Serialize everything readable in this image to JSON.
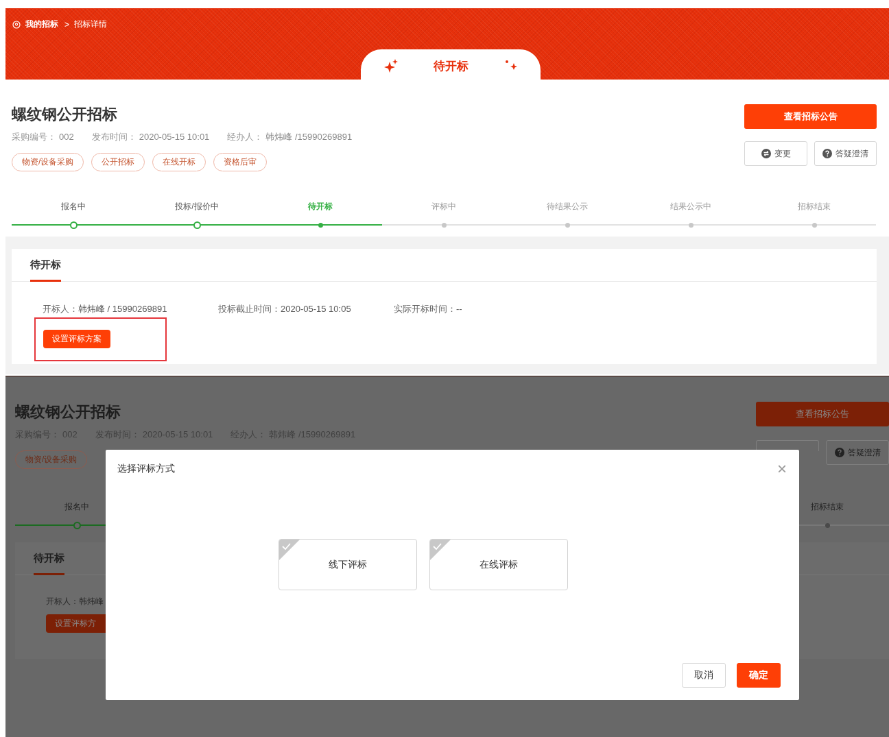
{
  "breadcrumb": {
    "items": [
      "我的招标",
      "招标详情"
    ],
    "separator": ">"
  },
  "status_tab": {
    "label": "待开标"
  },
  "project": {
    "title": "螺纹钢公开招标",
    "meta": [
      {
        "label": "采购编号：",
        "value": "002"
      },
      {
        "label": "发布时间：",
        "value": "2020-05-15 10:01"
      },
      {
        "label": "经办人：",
        "value": "韩炜峰 /15990269891"
      }
    ],
    "tags": [
      "物资/设备采购",
      "公开招标",
      "在线开标",
      "资格后审"
    ],
    "primary_button": "查看招标公告",
    "secondary_buttons": [
      {
        "kind": "change",
        "label": "变更"
      },
      {
        "kind": "question",
        "label": "答疑澄清"
      }
    ]
  },
  "steps": [
    {
      "label": "报名中",
      "kind": "done"
    },
    {
      "label": "投标/报价中",
      "kind": "done"
    },
    {
      "label": "待开标",
      "kind": "current"
    },
    {
      "label": "评标中",
      "kind": "pending"
    },
    {
      "label": "待结果公示",
      "kind": "pending"
    },
    {
      "label": "结果公示中",
      "kind": "pending"
    },
    {
      "label": "招标结束",
      "kind": "pending"
    }
  ],
  "section": {
    "tab": "待开标",
    "fields": [
      {
        "label": "开标人：",
        "value": "韩炜峰 / 15990269891"
      },
      {
        "label": "投标截止时间：",
        "value": "2020-05-15 10:05"
      },
      {
        "label": "实际开标时间：",
        "value": "--"
      }
    ],
    "button": "设置评标方案",
    "highlighted": true
  },
  "dialog_view": {
    "background": {
      "title": "螺纹钢公开招标",
      "meta": [
        {
          "label": "采购编号：",
          "value": "002"
        },
        {
          "label": "发布时间：",
          "value": "2020-05-15 10:01"
        },
        {
          "label": "经办人：",
          "value": "韩炜峰 /15990269891"
        }
      ],
      "tags": [
        "物资/设备采购"
      ],
      "primary_button": "查看招标公告",
      "secondary_buttons": [
        {
          "kind": "change"
        },
        {
          "kind": "question",
          "label": "答疑澄清"
        }
      ],
      "steps": [
        {
          "label": "报名中",
          "kind": "done"
        },
        {
          "label": "招标结束",
          "kind": "pending"
        }
      ],
      "section": {
        "tab": "待开标",
        "field": "开标人：韩炜峰",
        "button": "设置评标方"
      }
    },
    "dialog": {
      "title": "选择评标方式",
      "close": "×",
      "options": [
        {
          "label": "线下评标",
          "selected": false
        },
        {
          "label": "在线评标",
          "selected": false
        }
      ],
      "buttons": [
        {
          "kind": "secondary",
          "label": "取消"
        },
        {
          "kind": "primary",
          "label": "确定"
        }
      ]
    }
  }
}
